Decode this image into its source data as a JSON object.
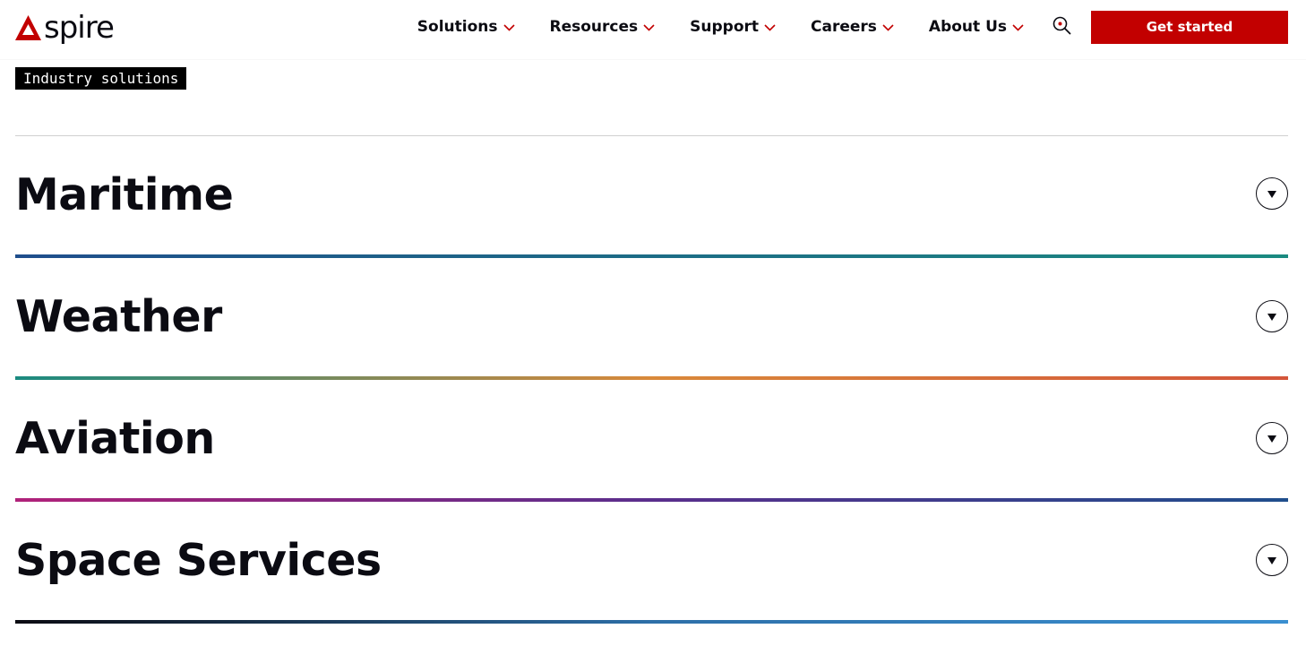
{
  "header": {
    "logo_text": "spire",
    "nav": [
      {
        "label": "Solutions"
      },
      {
        "label": "Resources"
      },
      {
        "label": "Support"
      },
      {
        "label": "Careers"
      },
      {
        "label": "About Us"
      }
    ],
    "cta_label": "Get started"
  },
  "main": {
    "tag_label": "Industry solutions",
    "accordion": [
      {
        "title": "Maritime",
        "line_colors": [
          "#1f4e8c",
          "#1a8a80"
        ]
      },
      {
        "title": "Weather",
        "line_colors": [
          "#1a8a80",
          "#d9893a",
          "#d4553a"
        ]
      },
      {
        "title": "Aviation",
        "line_colors": [
          "#b0227a",
          "#5a2e8c",
          "#1f4e8c"
        ]
      },
      {
        "title": "Space Services",
        "line_colors": [
          "#0b0b12",
          "#2d6fa8",
          "#3a8fd0"
        ]
      }
    ]
  },
  "colors": {
    "brand_red": "#c20000",
    "text": "#0b0b12",
    "chevron": "#c20000"
  },
  "icons": {
    "logo": "spire-logo-icon",
    "nav_chevron": "chevron-down-icon",
    "search": "search-icon",
    "toggle": "caret-down-icon"
  }
}
